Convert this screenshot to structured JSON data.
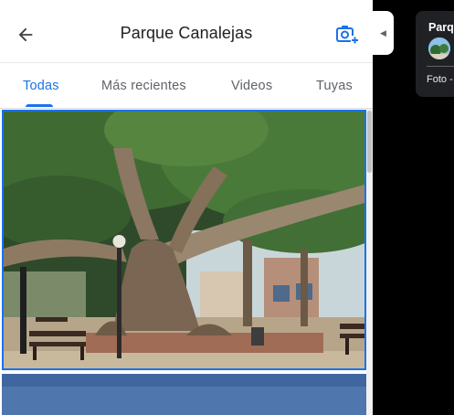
{
  "header": {
    "title": "Parque Canalejas"
  },
  "tabs": [
    {
      "label": "Todas",
      "active": true
    },
    {
      "label": "Más recientes",
      "active": false
    },
    {
      "label": "Videos",
      "active": false
    },
    {
      "label": "Tuyas",
      "active": false
    }
  ],
  "icons": {
    "back": "arrow-back-icon",
    "add_photo": "add-photo-camera-icon",
    "collapse": "collapse-left-icon"
  },
  "colors": {
    "accent": "#1a73e8",
    "text_primary": "#202124",
    "text_secondary": "#5f6368"
  },
  "right_card": {
    "title": "Parqu",
    "subtitle": "Foto -"
  }
}
